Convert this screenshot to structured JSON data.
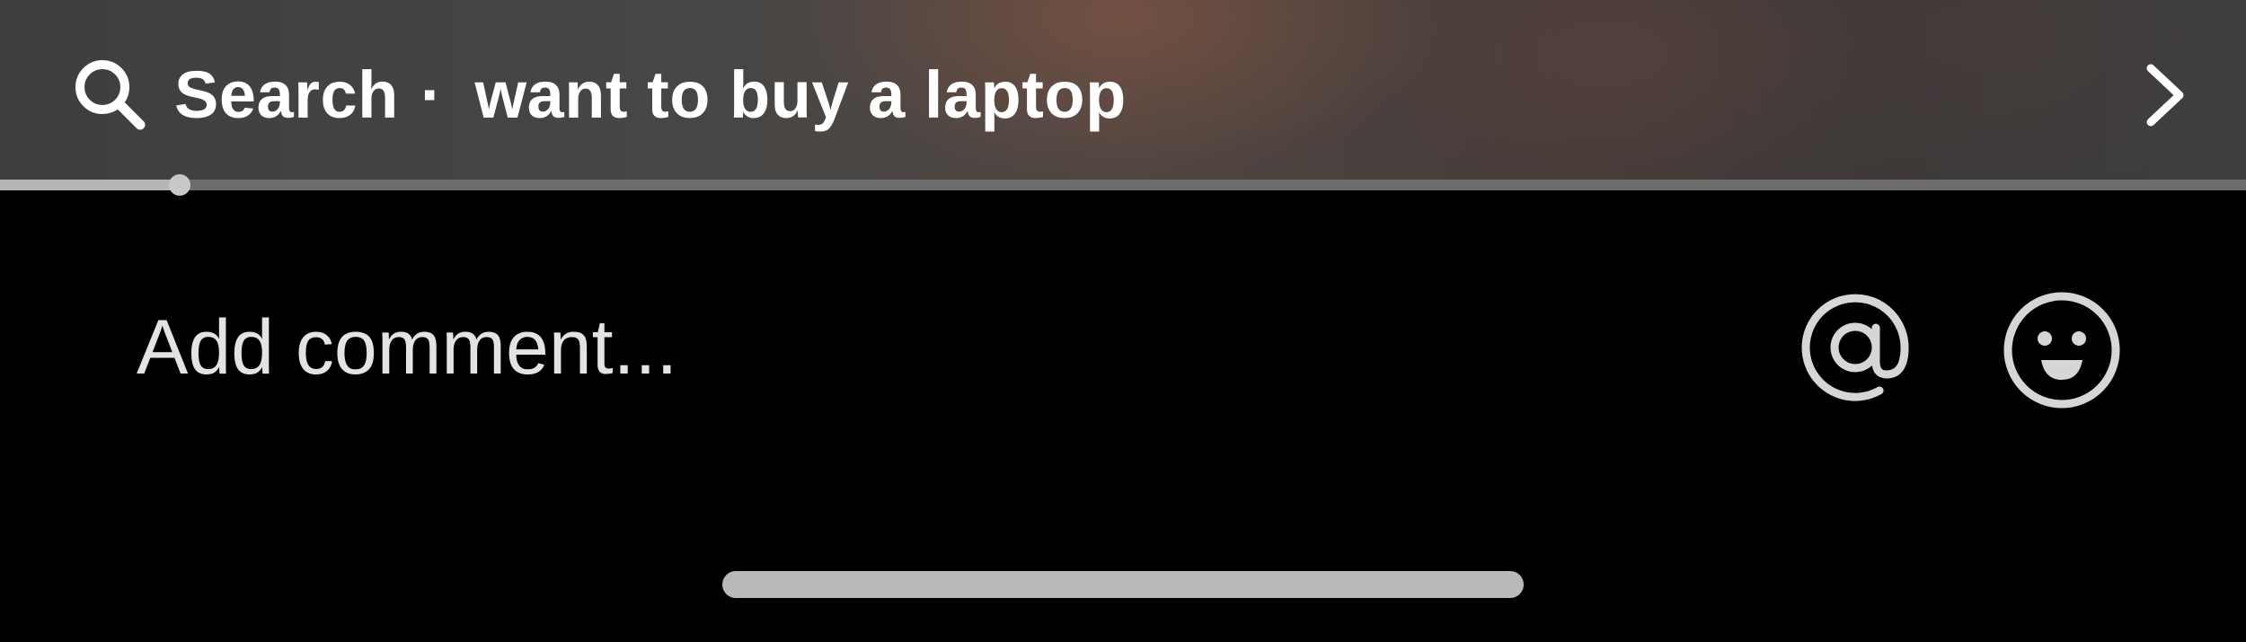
{
  "search_bar": {
    "label": "Search",
    "separator": "·",
    "query": "want to buy a laptop",
    "search_icon": "search-icon",
    "next_icon": "chevron-right-icon"
  },
  "progress": {
    "fraction": 0.08
  },
  "comment": {
    "placeholder": "Add comment...",
    "mention_icon": "at-sign-icon",
    "emoji_icon": "emoji-icon"
  },
  "colors": {
    "text": "#ffffff",
    "background": "#000000",
    "track": "#6c6c6c",
    "track_fill": "#b5b5b5",
    "home_indicator": "#b9b9b9"
  }
}
